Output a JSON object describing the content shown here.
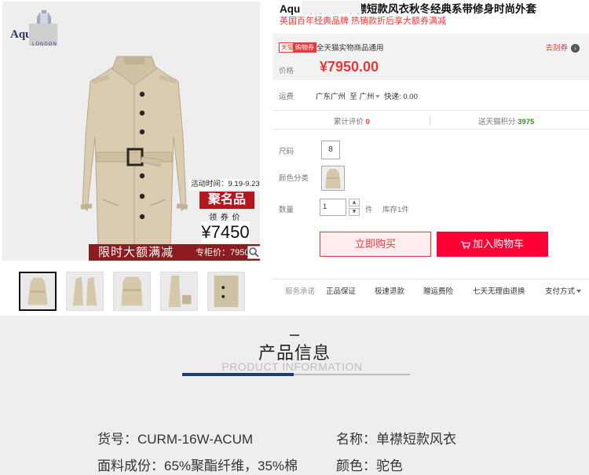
{
  "brand": {
    "name": "Aqu      um",
    "sub": "LONDON"
  },
  "promo": {
    "event_time": "活动时间：9.19-9.23",
    "ju_label": "聚名品",
    "coupon_label": "领 券 价",
    "coupon_price": "¥7450",
    "limit_text": "限时大额满减",
    "counter_price": "专柜价：7950"
  },
  "product": {
    "title": "Aqu              狮丹女士单襟短款风衣秋冬经典系带修身时尚外套",
    "subtitle": "英国百年经典品牌 热销款折后享大额券满减"
  },
  "coupon_bar": {
    "tag_tmall": "天猫",
    "tag_coupon": "购物券",
    "desc": "全天猫实物商品通用",
    "get_coupon": "去刮券",
    "price_label": "价格",
    "price": "¥7950.00"
  },
  "shipping": {
    "label": "运费",
    "from": "广东广州",
    "to_word": "至",
    "to": "广州",
    "method": "快递: 0.00"
  },
  "stats": {
    "reviews_label": "累计评价",
    "reviews_count": "0",
    "points_label": "送天猫积分",
    "points_count": "3975"
  },
  "options": {
    "size_label": "尺码",
    "size_value": "8",
    "color_label": "颜色分类",
    "qty_label": "数量",
    "qty_value": "1",
    "qty_unit": "件",
    "stock": "库存1件"
  },
  "actions": {
    "buy_now": "立即购买",
    "add_cart": "加入购物车"
  },
  "services": {
    "label": "服务承诺",
    "items": [
      "正品保证",
      "极速退款",
      "赠运费险",
      "七天无理由退换"
    ],
    "payment": "支付方式"
  },
  "product_info": {
    "title": "产品信息",
    "subtitle": "PRODUCT INFORMATION",
    "rows": [
      {
        "left": "货号：CURM-16W-ACUM",
        "right": "名称：单襟短款风衣"
      },
      {
        "left": "面料成份：65%聚酯纤维，35%棉",
        "right": "颜色：驼色"
      }
    ]
  },
  "colors": {
    "accent_red": "#e4393c",
    "cart_red": "#ff0036",
    "promo_maroon": "#8c1c1f",
    "info_accent": "#1f3d6e"
  }
}
